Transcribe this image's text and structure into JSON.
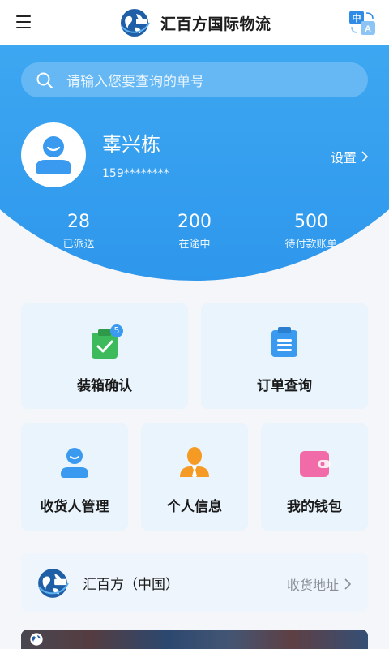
{
  "header": {
    "title": "汇百方国际物流"
  },
  "search": {
    "placeholder": "请输入您要查询的单号"
  },
  "user": {
    "name": "辜兴栋",
    "phone": "159********",
    "settings_label": "设置"
  },
  "stats": [
    {
      "value": "28",
      "label": "已派送"
    },
    {
      "value": "200",
      "label": "在途中"
    },
    {
      "value": "500",
      "label": "待付款账单"
    }
  ],
  "cards": {
    "packing_confirm": {
      "label": "装箱确认",
      "badge": "5"
    },
    "order_query": {
      "label": "订单查询"
    },
    "consignee_manage": {
      "label": "收货人管理"
    },
    "personal_info": {
      "label": "个人信息"
    },
    "my_wallet": {
      "label": "我的钱包"
    }
  },
  "company": {
    "name": "汇百方（中国）",
    "link_label": "收货地址"
  },
  "colors": {
    "primary": "#3ea8f2",
    "card_bg": "#e9f4fd",
    "icon_green": "#3dbb5c",
    "icon_blue": "#3a9af0",
    "icon_orange": "#f59a23",
    "icon_pink": "#f06ba8"
  },
  "icons": {
    "menu": "menu-icon",
    "translate": "translate-icon",
    "search": "search-icon",
    "settings_chevron": "chevron-right-icon"
  }
}
